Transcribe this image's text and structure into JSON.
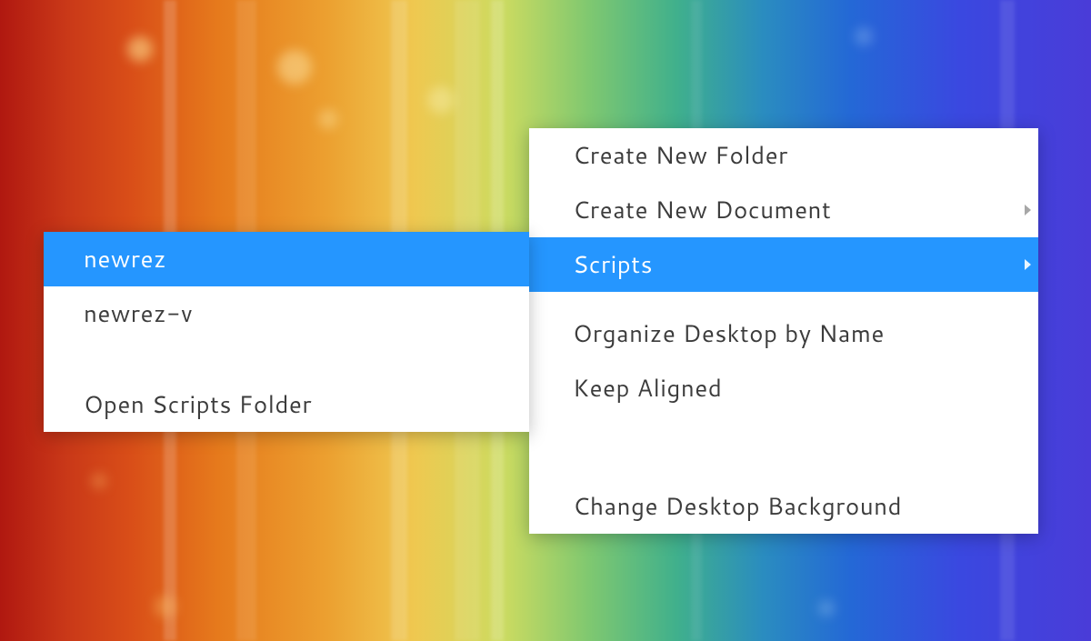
{
  "contextMenu": {
    "items": [
      {
        "label": "Create New Folder",
        "highlighted": false,
        "submenu": false
      },
      {
        "label": "Create New Document",
        "highlighted": false,
        "submenu": true
      },
      {
        "label": "Scripts",
        "highlighted": true,
        "submenu": true
      },
      {
        "label": "Organize Desktop by Name",
        "highlighted": false,
        "submenu": false
      },
      {
        "label": "Keep Aligned",
        "highlighted": false,
        "submenu": false
      },
      {
        "label": "Change Desktop Background",
        "highlighted": false,
        "submenu": false
      }
    ]
  },
  "scriptsSubmenu": {
    "items": [
      {
        "label": "newrez",
        "highlighted": true
      },
      {
        "label": "newrez-v",
        "highlighted": false
      },
      {
        "label": "",
        "highlighted": false
      },
      {
        "label": "Open Scripts Folder",
        "highlighted": false
      }
    ]
  },
  "colors": {
    "highlight": "#2596ff",
    "menuBg": "#ffffff",
    "menuText": "#3c3c3c"
  }
}
